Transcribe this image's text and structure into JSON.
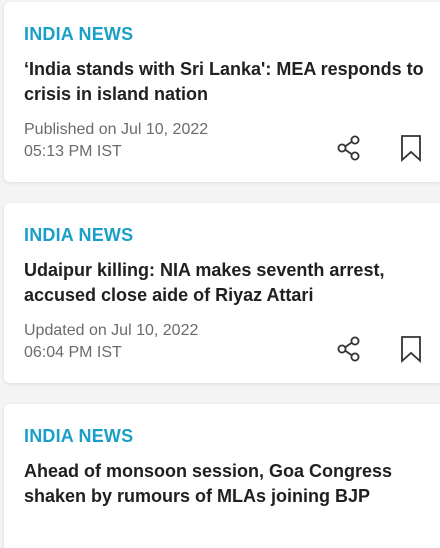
{
  "articles": [
    {
      "category": "INDIA NEWS",
      "headline": "‘India stands with Sri Lanka': MEA responds to crisis in island nation",
      "date_line": "Published on Jul 10, 2022",
      "time_line": "05:13 PM IST"
    },
    {
      "category": "INDIA NEWS",
      "headline": "Udaipur killing: NIA makes seventh arrest, accused close aide of Riyaz Attari",
      "date_line": "Updated on Jul 10, 2022",
      "time_line": "06:04 PM IST"
    },
    {
      "category": "INDIA NEWS",
      "headline": "Ahead of monsoon session, Goa Congress shaken by rumours of MLAs joining BJP"
    }
  ],
  "icons": {
    "share": "share-icon",
    "bookmark": "bookmark-icon"
  },
  "colors": {
    "category": "#1a9fc9",
    "headline": "#202020",
    "meta": "#6b6b6b",
    "icon": "#333333"
  }
}
